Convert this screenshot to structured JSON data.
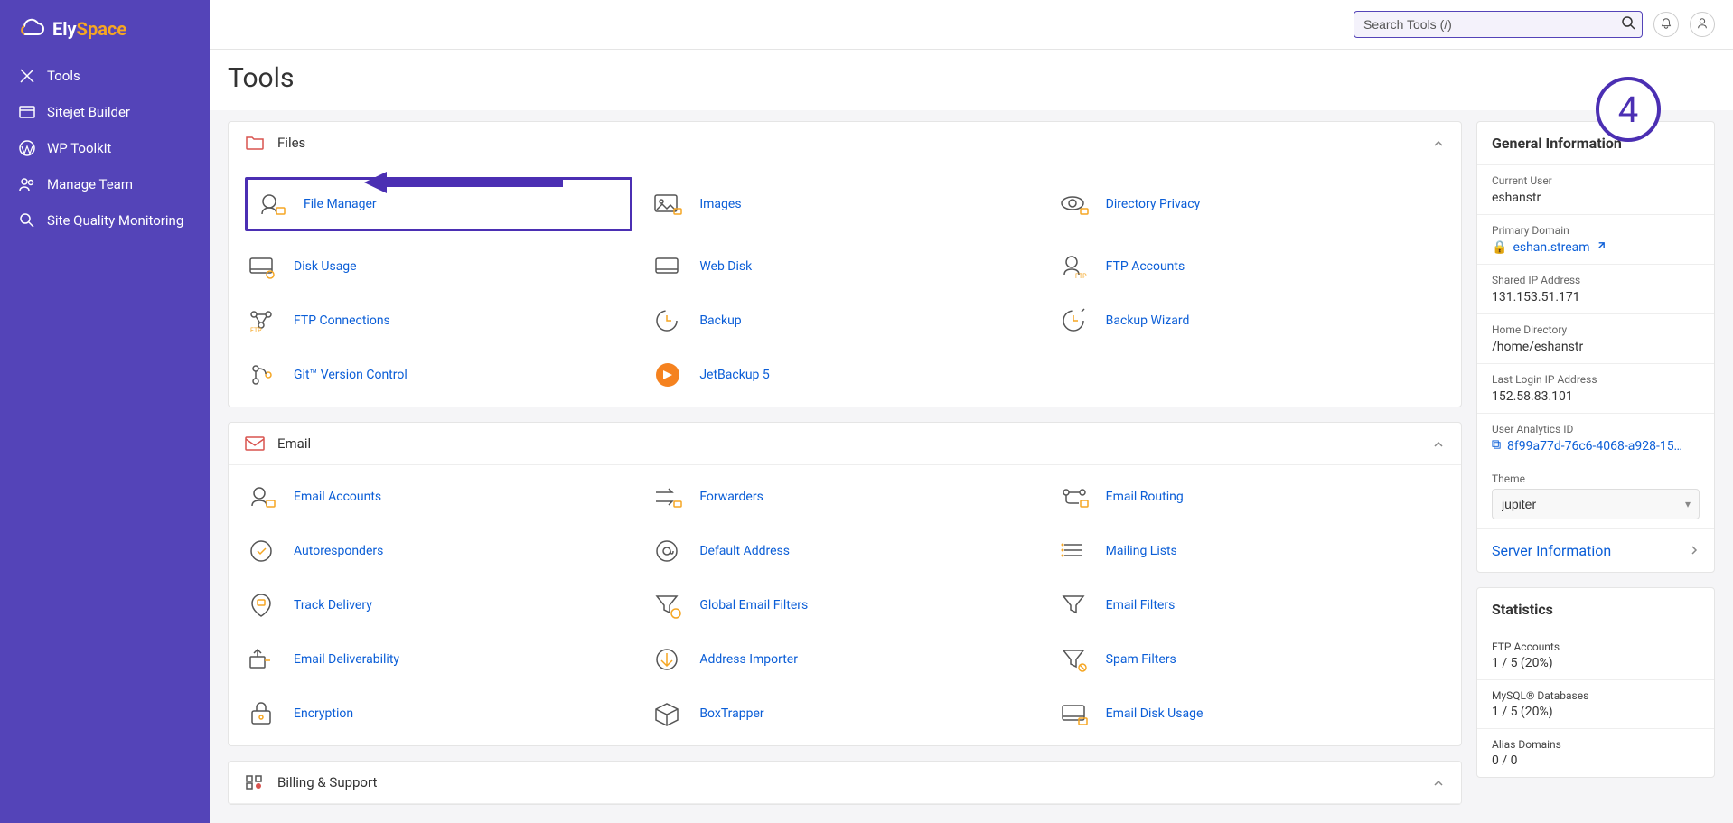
{
  "brand": {
    "name_part1": "Ely",
    "name_part2": "Space"
  },
  "sidebar": {
    "items": [
      {
        "label": "Tools"
      },
      {
        "label": "Sitejet Builder"
      },
      {
        "label": "WP Toolkit"
      },
      {
        "label": "Manage Team"
      },
      {
        "label": "Site Quality Monitoring"
      }
    ]
  },
  "search": {
    "placeholder": "Search Tools (/)"
  },
  "page": {
    "title": "Tools"
  },
  "sections": {
    "files": {
      "title": "Files",
      "items": [
        {
          "label": "File Manager",
          "highlight": true
        },
        {
          "label": "Images"
        },
        {
          "label": "Directory Privacy"
        },
        {
          "label": "Disk Usage"
        },
        {
          "label": "Web Disk"
        },
        {
          "label": "FTP Accounts"
        },
        {
          "label": "FTP Connections"
        },
        {
          "label": "Backup"
        },
        {
          "label": "Backup Wizard"
        },
        {
          "label": "Git™ Version Control"
        },
        {
          "label": "JetBackup 5"
        }
      ]
    },
    "email": {
      "title": "Email",
      "items": [
        {
          "label": "Email Accounts"
        },
        {
          "label": "Forwarders"
        },
        {
          "label": "Email Routing"
        },
        {
          "label": "Autoresponders"
        },
        {
          "label": "Default Address"
        },
        {
          "label": "Mailing Lists"
        },
        {
          "label": "Track Delivery"
        },
        {
          "label": "Global Email Filters"
        },
        {
          "label": "Email Filters"
        },
        {
          "label": "Email Deliverability"
        },
        {
          "label": "Address Importer"
        },
        {
          "label": "Spam Filters"
        },
        {
          "label": "Encryption"
        },
        {
          "label": "BoxTrapper"
        },
        {
          "label": "Email Disk Usage"
        }
      ]
    },
    "billing": {
      "title": "Billing & Support"
    }
  },
  "info": {
    "heading": "General Information",
    "current_user_label": "Current User",
    "current_user": "eshanstr",
    "primary_domain_label": "Primary Domain",
    "primary_domain": "eshan.stream",
    "shared_ip_label": "Shared IP Address",
    "shared_ip": "131.153.51.171",
    "home_dir_label": "Home Directory",
    "home_dir": "/home/eshanstr",
    "last_login_label": "Last Login IP Address",
    "last_login": "152.58.83.101",
    "analytics_label": "User Analytics ID",
    "analytics_id": "8f99a77d-76c6-4068-a928-15…",
    "theme_label": "Theme",
    "theme_value": "jupiter",
    "server_info": "Server Information"
  },
  "stats": {
    "heading": "Statistics",
    "ftp_label": "FTP Accounts",
    "ftp_value": "1 / 5   (20%)",
    "mysql_label": "MySQL® Databases",
    "mysql_value": "1 / 5   (20%)",
    "alias_label": "Alias Domains",
    "alias_value": "0 / 0"
  },
  "annotation": {
    "badge": "4"
  }
}
